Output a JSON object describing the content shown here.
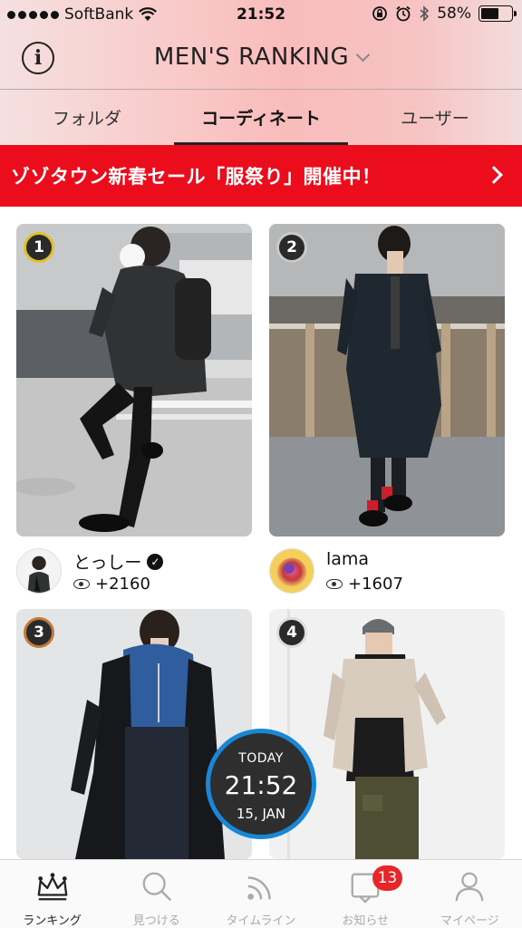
{
  "status_bar": {
    "carrier": "SoftBank",
    "time": "21:52",
    "battery": "58%",
    "battery_level": 0.58
  },
  "navbar": {
    "title": "MEN'S RANKING"
  },
  "tabs": [
    {
      "label": "フォルダ"
    },
    {
      "label": "コーディネート"
    },
    {
      "label": "ユーザー"
    }
  ],
  "banner": {
    "text": "ゾゾタウン新春セール「服祭り」開催中！"
  },
  "ranking": [
    {
      "rank": "1",
      "user": "とっしー",
      "verified": true,
      "views": "+2160"
    },
    {
      "rank": "2",
      "user": "lama",
      "verified": false,
      "views": "+1607"
    },
    {
      "rank": "3"
    },
    {
      "rank": "4"
    }
  ],
  "clock": {
    "label": "TODAY",
    "time": "21:52",
    "date": "15, JAN"
  },
  "tabbar": [
    {
      "label": "ランキング"
    },
    {
      "label": "見つける"
    },
    {
      "label": "タイムライン"
    },
    {
      "label": "お知らせ",
      "badge": "13"
    },
    {
      "label": "マイページ"
    }
  ],
  "colors": {
    "banner": "#ec0d1c",
    "clock_ring": "#1a86d6",
    "badge": "#e8262a"
  }
}
